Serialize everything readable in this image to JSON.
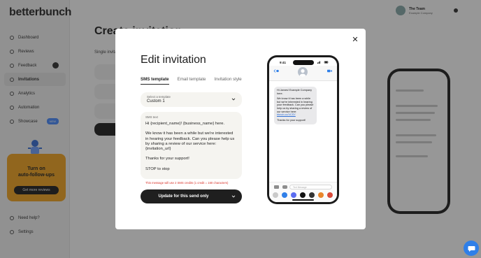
{
  "app": {
    "logo": "betterbunch",
    "page_title": "Create invitation",
    "user_name": "The Team",
    "user_company": "Example Company",
    "nav": [
      {
        "label": "Dashboard"
      },
      {
        "label": "Reviews"
      },
      {
        "label": "Feedback"
      },
      {
        "label": "Invitations"
      },
      {
        "label": "Analytics"
      },
      {
        "label": "Automation"
      },
      {
        "label": "Showcase",
        "badge": "NEW"
      }
    ],
    "nav_bottom": [
      {
        "label": "Need help?"
      },
      {
        "label": "Settings"
      }
    ],
    "promo": {
      "line1": "Turn on",
      "line2": "auto-follow-ups",
      "button": "Get more reviews"
    },
    "background_labels": {
      "single_label": "Single invitation"
    }
  },
  "modal": {
    "title": "Edit invitation",
    "close_symbol": "✕",
    "tabs": [
      {
        "label": "SMS template",
        "active": true
      },
      {
        "label": "Email template",
        "active": false
      },
      {
        "label": "Invitation style",
        "active": false
      }
    ],
    "template_select": {
      "caption": "Select a template",
      "value": "Custom 1"
    },
    "sms": {
      "caption": "SMS text",
      "text": "Hi {recipient_name}! {business_name} here.\n\nWe know it has been a while but we're interested in hearing your feedback. Can you please help us by sharing a review of our service here: {invitation_url}\n\nThanks for your support!\n\nSTOP to stop"
    },
    "warning": "This message will use 2 SMS credits (1 credit = 160 characters)",
    "update_button": "Update for this send only"
  },
  "phone": {
    "time": "9:41",
    "bubble": {
      "greeting": "Hi James! Example Company here.",
      "body": "We know it has been a while but we're interested in hearing your feedback. Can you please help us by sharing a review of our service here:",
      "link": "bbnch.co/VCSY",
      "thanks": "Thanks for your support!"
    },
    "compose_placeholder": "Text Message"
  },
  "colors": {
    "primary_dark": "#1f1f1f",
    "warning_red": "#d9342b",
    "field_bg": "#f5f4f0",
    "promo_orange": "#f5a623",
    "chat_blue": "#2f7fe8"
  },
  "icons": [
    "close-icon",
    "chevron-down-icon",
    "back-chevron-icon",
    "video-icon",
    "camera-icon",
    "chat-bubble-icon"
  ]
}
